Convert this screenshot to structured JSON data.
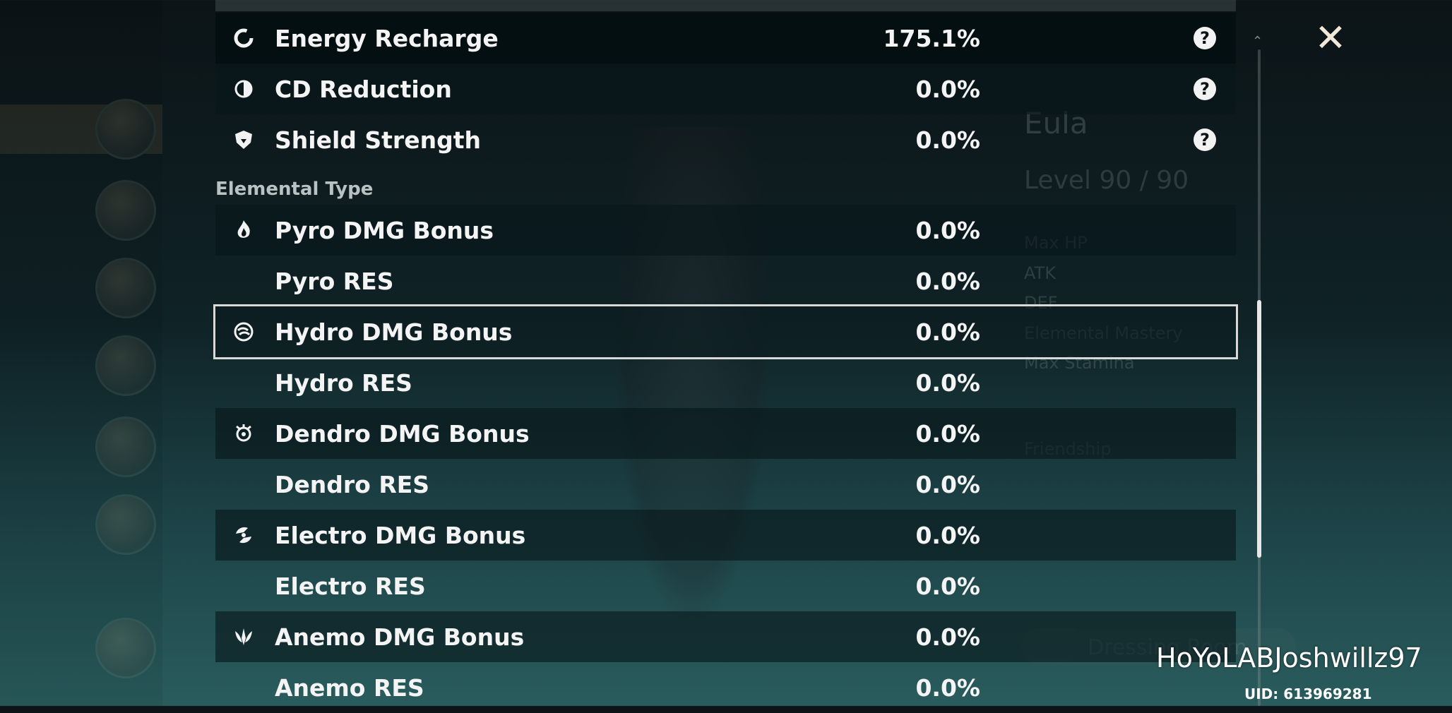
{
  "background": {
    "character_name": "Eula",
    "level_text": "Level 90 / 90",
    "stats": [
      "Max HP",
      "ATK",
      "DEF",
      "Elemental Mastery",
      "Max Stamina"
    ],
    "friendship": "Friendship",
    "dressing_room": "Dressing Room"
  },
  "stats_panel": {
    "rows_top": [
      {
        "label": "Energy Recharge",
        "value": "175.1%",
        "icon": "energy-recharge-icon",
        "help": "?"
      },
      {
        "label": "CD Reduction",
        "value": "0.0%",
        "icon": "cd-reduction-icon",
        "help": "?"
      },
      {
        "label": "Shield Strength",
        "value": "0.0%",
        "icon": "shield-icon",
        "help": "?"
      }
    ],
    "section_title": "Elemental Type",
    "elemental_rows": [
      {
        "label": "Pyro DMG Bonus",
        "value": "0.0%",
        "icon": "pyro-icon"
      },
      {
        "label": "Pyro RES",
        "value": "0.0%"
      },
      {
        "label": "Hydro DMG Bonus",
        "value": "0.0%",
        "icon": "hydro-icon"
      },
      {
        "label": "Hydro RES",
        "value": "0.0%"
      },
      {
        "label": "Dendro DMG Bonus",
        "value": "0.0%",
        "icon": "dendro-icon"
      },
      {
        "label": "Dendro RES",
        "value": "0.0%"
      },
      {
        "label": "Electro DMG Bonus",
        "value": "0.0%",
        "icon": "electro-icon"
      },
      {
        "label": "Electro RES",
        "value": "0.0%"
      },
      {
        "label": "Anemo DMG Bonus",
        "value": "0.0%",
        "icon": "anemo-icon"
      },
      {
        "label": "Anemo RES",
        "value": "0.0%"
      }
    ]
  },
  "close_label": "✕",
  "watermark": "HoYoLABJoshwillz97",
  "uid": "UID: 613969281"
}
